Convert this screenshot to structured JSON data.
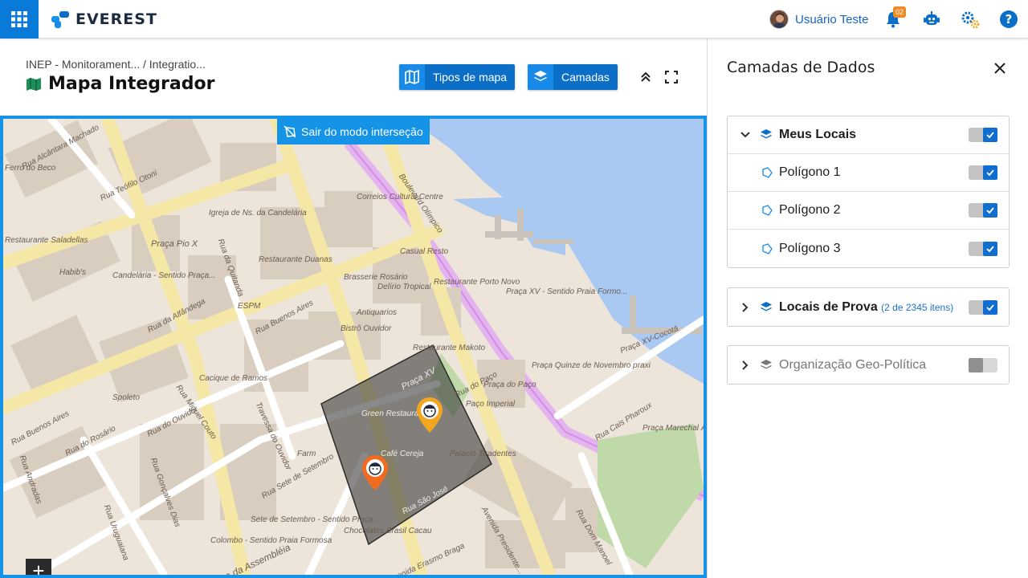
{
  "app": {
    "name": "EVEREST"
  },
  "topbar": {
    "user_name": "Usuário Teste",
    "notification_count": "02"
  },
  "header": {
    "breadcrumb": "INEP - Monitorament... / Integratio...",
    "title": "Mapa Integrador",
    "map_types_label": "Tipos de mapa",
    "layers_label": "Camadas"
  },
  "map": {
    "exit_intersection_label": "Sair do modo interseção",
    "zoom_in_label": "+",
    "labels": [
      "Rua Alcântara Machado",
      "Rua Teófilo Otoni",
      "Igreja de Ns. da Candelária",
      "Praça Pio X",
      "Rua da Quitanda",
      "Correios Cultural Centre",
      "Boulevard Olímpico",
      "Casual Resto",
      "Restaurante Duanas",
      "Candelária - Sentido Praça...",
      "Rua da Alfândega",
      "Brasserie Rosário",
      "Delírio Tropical",
      "Restaurante Porto Novo",
      "Praça XV - Sentido Praia Formo...",
      "Rua Buenos Aires",
      "Antiquarios",
      "Bistrô Ouvidor",
      "Restaurante Makoto",
      "Praça XV",
      "Praça Quinze de Novembro praxi",
      "Praça XV-Cocotá",
      "Praça do Paço",
      "Paço Imperial",
      "Cacique de Ramos",
      "Spoleto",
      "Green Restaurante",
      "Café Cereja",
      "Palácio Tiradentes",
      "Rua do Ouvidor",
      "Travessa do Ouvidor",
      "Rua Cais Pharoux",
      "Praça Marechal Âncora",
      "Farm",
      "Rua do Rosário",
      "Rua Gonçalves Dias",
      "Rua Uruguaiana",
      "Sete de Setembro - Sentido Praça...",
      "Colombo - Sentido Praia Formosa",
      "Rua Sete de Setembro",
      "Rua São José",
      "Chocolates Brasil Cacau",
      "Avenida Presidente...",
      "Rua Dom Manoel",
      "Rua da Assembléia",
      "Avenida Erasmo Braga",
      "Rua Buenos Aires",
      "Habib's",
      "Restaurante Saladellas",
      "ESPM",
      "Rua do Paço",
      "Rua Miguel Couto",
      "Rua Andradas",
      "Ferro do Beco"
    ]
  },
  "panel": {
    "title": "Camadas de Dados",
    "groups": [
      {
        "name": "Meus Locais",
        "sub": "",
        "expanded": true,
        "enabled": true,
        "items": [
          {
            "name": "Polígono 1",
            "enabled": true
          },
          {
            "name": "Polígono 2",
            "enabled": true
          },
          {
            "name": "Polígono 3",
            "enabled": true
          }
        ]
      },
      {
        "name": "Locais de Prova",
        "sub": "(2 de 2345 itens)",
        "expanded": false,
        "enabled": true
      },
      {
        "name": "Organização Geo-Política",
        "sub": "",
        "expanded": false,
        "enabled": false
      }
    ]
  },
  "colors": {
    "primary": "#0c6fc7",
    "accent_blue": "#1593e6",
    "map_water": "#a7c8f2",
    "pin_orange": "#f36a21",
    "pin_yellow": "#f3a61f",
    "polygon_fill": "#3a3a3a"
  }
}
